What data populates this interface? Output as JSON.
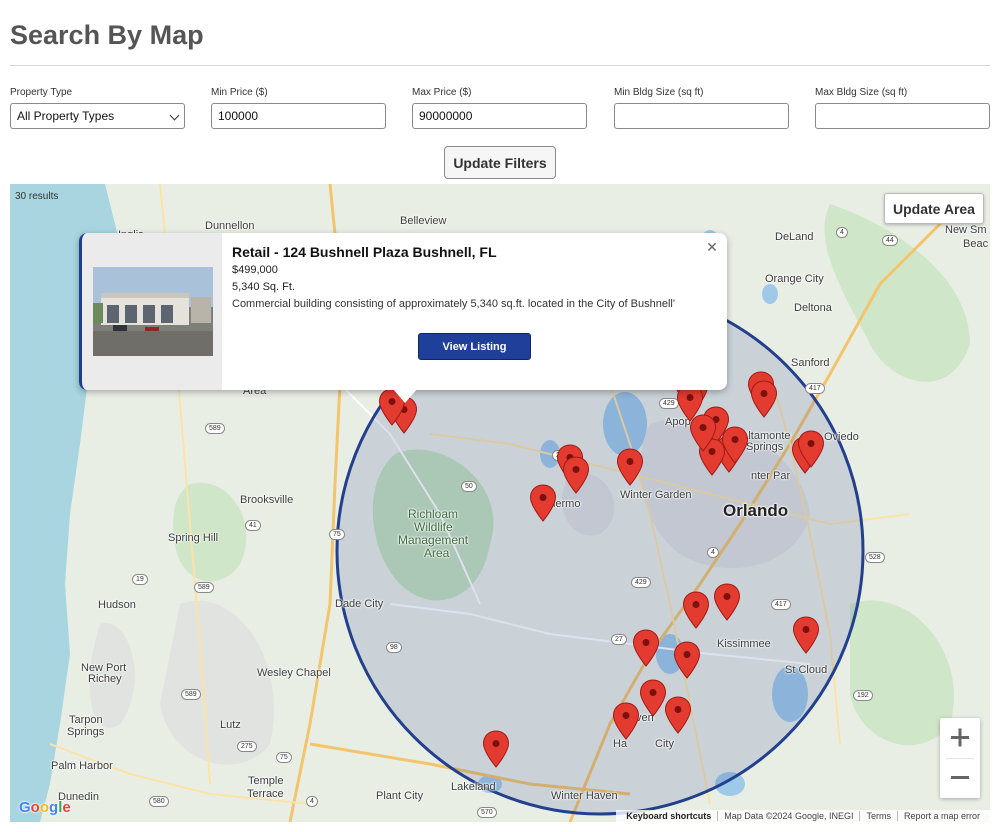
{
  "page": {
    "title": "Search By Map"
  },
  "filters": {
    "property_type": {
      "label": "Property Type",
      "value": "All Property Types",
      "options": [
        "All Property Types"
      ]
    },
    "min_price": {
      "label": "Min Price ($)",
      "value": "100000"
    },
    "max_price": {
      "label": "Max Price ($)",
      "value": "90000000"
    },
    "min_bldg": {
      "label": "Min Bldg Size (sq ft)",
      "value": ""
    },
    "max_bldg": {
      "label": "Max Bldg Size (sq ft)",
      "value": ""
    },
    "update_label": "Update Filters"
  },
  "map": {
    "results": "30 results",
    "update_area_label": "Update Area",
    "zoom_in_icon": "plus-icon",
    "zoom_out_icon": "minus-icon",
    "google_logo": "Google",
    "attribution": {
      "shortcuts": "Keyboard shortcuts",
      "map_data": "Map Data ©2024 Google, INEGI",
      "terms": "Terms",
      "report": "Report a map error"
    },
    "places": {
      "dunnellon": "Dunnellon",
      "inglis": "Inglis",
      "belleview": "Belleview",
      "deland": "DeLand",
      "new_smyrna": "New Sm",
      "new_smyrna2": "Beac",
      "orange_city": "Orange City",
      "deltona": "Deltona",
      "sanford": "Sanford",
      "area": "Area",
      "apopka": "Apop",
      "altamonte": "Altamonte",
      "springs": "Springs",
      "oviedo": "Oviedo",
      "winter_park": "nter Par",
      "winter_garden": "Winter Garden",
      "clermont": "Clermo",
      "orlando": "Orlando",
      "brooksville": "Brooksville",
      "spring_hill": "Spring Hill",
      "richloam1": "Richloam",
      "richloam2": "Wildlife",
      "richloam3": "Management",
      "richloam4": "Area",
      "hudson": "Hudson",
      "dade_city": "Dade City",
      "kissimmee": "Kissimmee",
      "st_cloud": "St Cloud",
      "new_port": "New Port",
      "richey": "Richey",
      "wesley_chapel": "Wesley Chapel",
      "tarpon": "Tarpon",
      "tarpon2": "Springs",
      "lutz": "Lutz",
      "palm_harbor": "Palm Harbor",
      "davenport": "Daven",
      "haines_city": "Ha",
      "haines_city2": "City",
      "temple": "Temple",
      "terrace": "Terrace",
      "dunedin": "Dunedin",
      "plant_city": "Plant City",
      "lakeland": "Lakeland",
      "winter_haven": "Winter Haven"
    },
    "shields": [
      "4",
      "44",
      "417",
      "429",
      "589",
      "27",
      "50",
      "41",
      "75",
      "19",
      "589",
      "98",
      "4",
      "417",
      "528",
      "27",
      "429",
      "589",
      "275",
      "75",
      "192",
      "4",
      "580",
      "570",
      "4"
    ]
  },
  "listing_popup": {
    "title": "Retail - 124 Bushnell Plaza Bushnell, FL",
    "price": "$499,000",
    "size": "5,340 Sq. Ft.",
    "description": "Commercial building consisting of approximately 5,340 sq.ft. located in the City of Bushnell'",
    "button_label": "View Listing",
    "close_icon": "close-icon"
  }
}
